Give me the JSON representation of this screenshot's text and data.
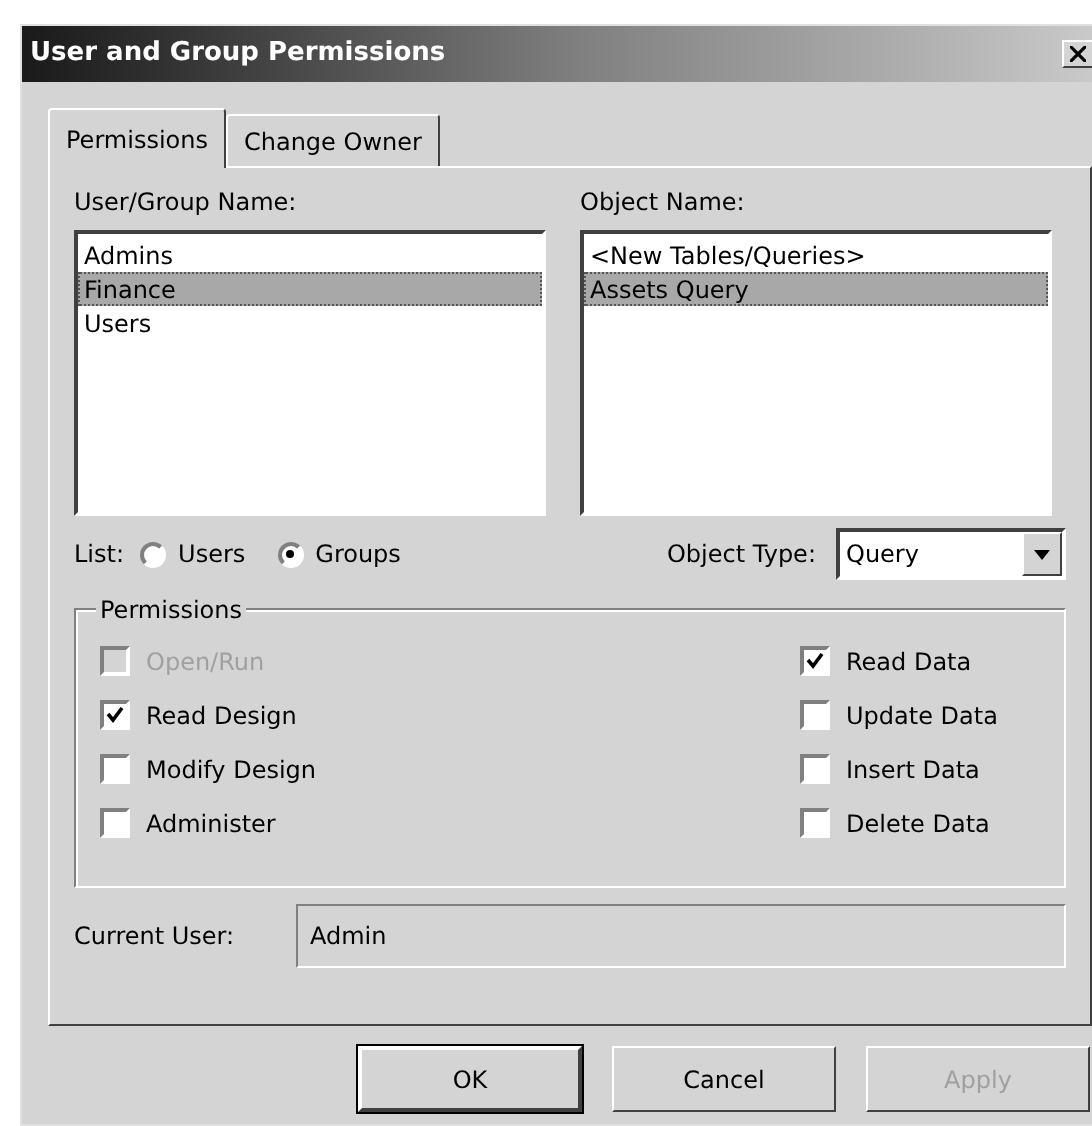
{
  "window": {
    "title": "User and Group Permissions"
  },
  "tabs": [
    {
      "label": "Permissions",
      "selected": true
    },
    {
      "label": "Change Owner",
      "selected": false
    }
  ],
  "user_group_list": {
    "label": "User/Group Name:",
    "items": [
      {
        "label": "Admins",
        "selected": false
      },
      {
        "label": "Finance",
        "selected": true
      },
      {
        "label": "Users",
        "selected": false
      }
    ]
  },
  "object_list": {
    "label": "Object Name:",
    "items": [
      {
        "label": "<New Tables/Queries>",
        "selected": false
      },
      {
        "label": "Assets Query",
        "selected": true
      }
    ]
  },
  "list_mode": {
    "label": "List:",
    "options": [
      {
        "label": "Users",
        "selected": false
      },
      {
        "label": "Groups",
        "selected": true
      }
    ]
  },
  "object_type": {
    "label": "Object Type:",
    "value": "Query"
  },
  "permissions": {
    "title": "Permissions",
    "left": [
      {
        "label": "Open/Run",
        "checked": false,
        "disabled": true
      },
      {
        "label": "Read Design",
        "checked": true,
        "disabled": false
      },
      {
        "label": "Modify Design",
        "checked": false,
        "disabled": false
      },
      {
        "label": "Administer",
        "checked": false,
        "disabled": false
      }
    ],
    "right": [
      {
        "label": "Read Data",
        "checked": true,
        "disabled": false
      },
      {
        "label": "Update Data",
        "checked": false,
        "disabled": false
      },
      {
        "label": "Insert Data",
        "checked": false,
        "disabled": false
      },
      {
        "label": "Delete Data",
        "checked": false,
        "disabled": false
      }
    ]
  },
  "current_user": {
    "label": "Current User:",
    "value": "Admin"
  },
  "buttons": [
    {
      "label": "OK",
      "disabled": false,
      "default": true
    },
    {
      "label": "Cancel",
      "disabled": false,
      "default": false
    },
    {
      "label": "Apply",
      "disabled": true,
      "default": false
    }
  ]
}
